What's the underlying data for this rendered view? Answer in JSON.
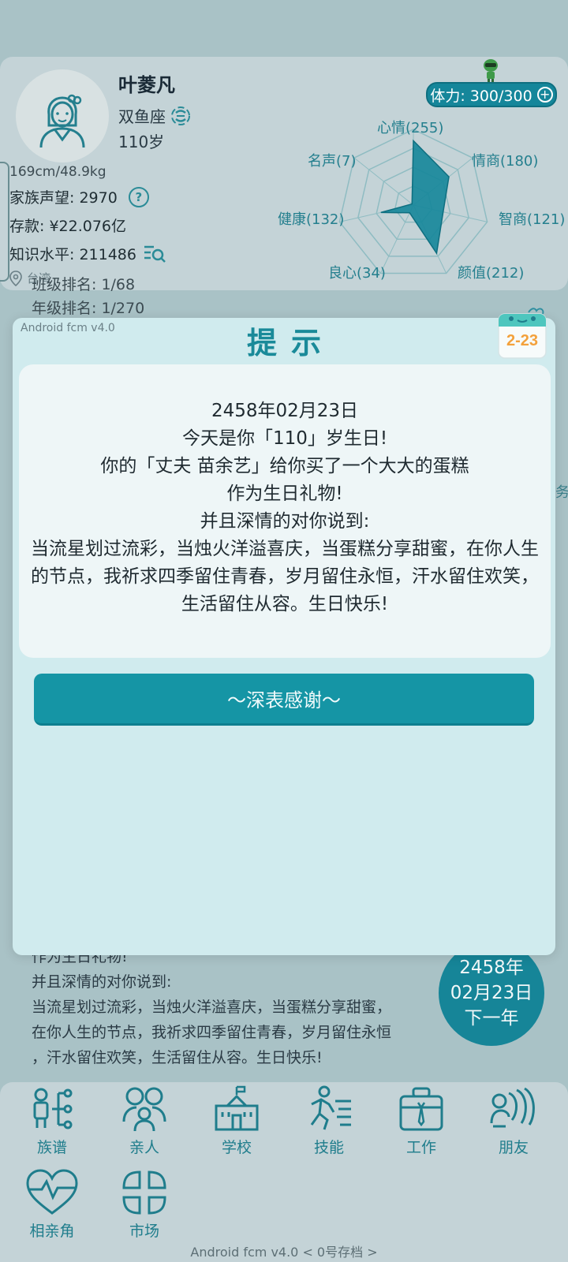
{
  "profile": {
    "name": "叶菱凡",
    "zodiac": "双鱼座",
    "age": "110岁",
    "height_weight": "169cm/48.9kg",
    "family_reputation": "家族声望: 2970",
    "savings": "存款: ¥22.076亿",
    "knowledge": "知识水平: 211486",
    "location": "台湾"
  },
  "stamina": {
    "label": "体力: 300/300",
    "plus": "+"
  },
  "radar": {
    "axes": [
      {
        "label": "心情(255)",
        "value": 255
      },
      {
        "label": "情商(180)",
        "value": 180
      },
      {
        "label": "智商(121)",
        "value": 121
      },
      {
        "label": "颜值(212)",
        "value": 212
      },
      {
        "label": "良心(34)",
        "value": 34
      },
      {
        "label": "健康(132)",
        "value": 132
      },
      {
        "label": "名声(7)",
        "value": 7
      }
    ],
    "fill_color": "#15869a"
  },
  "behind_text": {
    "class_rank": "班级排名: 1/68",
    "grade_rank": "年级排名: 1/270"
  },
  "modal": {
    "version": "Android fcm v4.0",
    "title": "提示",
    "calendar_badge": "2-23",
    "lines": [
      "2458年02月23日",
      "今天是你「110」岁生日!",
      "你的「丈夫 苗余艺」给你买了一个大大的蛋糕",
      "作为生日礼物!",
      "并且深情的对你说到:",
      "当流星划过流彩，当烛火洋溢喜庆，当蛋糕分享甜蜜，在你人生的节点，我祈求四季留住青春，岁月留住永恒，汗水留住欢笑，生活留住从容。生日快乐!"
    ],
    "button": "～深表感谢～"
  },
  "log_behind": {
    "line0": "作为生日礼物!",
    "line1": "并且深情的对你说到:",
    "line2": "当流星划过流彩，当烛火洋溢喜庆，当蛋糕分享甜蜜，",
    "line3": "在你人生的节点，我祈求四季留住青春，岁月留住永恒",
    "line4": "，汗水留住欢笑，生活留住从容。生日快乐!"
  },
  "date_circle": {
    "year": "2458年",
    "date": "02月23日",
    "next": "下一年"
  },
  "right_edge_glyph": "务",
  "nav": [
    {
      "label": "族谱",
      "icon": "family-tree-icon"
    },
    {
      "label": "亲人",
      "icon": "relatives-icon"
    },
    {
      "label": "学校",
      "icon": "school-icon"
    },
    {
      "label": "技能",
      "icon": "skill-icon"
    },
    {
      "label": "工作",
      "icon": "briefcase-icon"
    },
    {
      "label": "朋友",
      "icon": "friends-icon"
    },
    {
      "label": "相亲角",
      "icon": "heart-pulse-icon"
    },
    {
      "label": "市场",
      "icon": "market-icon"
    }
  ],
  "footer": "Android fcm v4.0  < 0号存档 >",
  "colors": {
    "teal": "#15869a",
    "modal_bg": "#d0ebee",
    "overlay": "#a9c2c6"
  }
}
